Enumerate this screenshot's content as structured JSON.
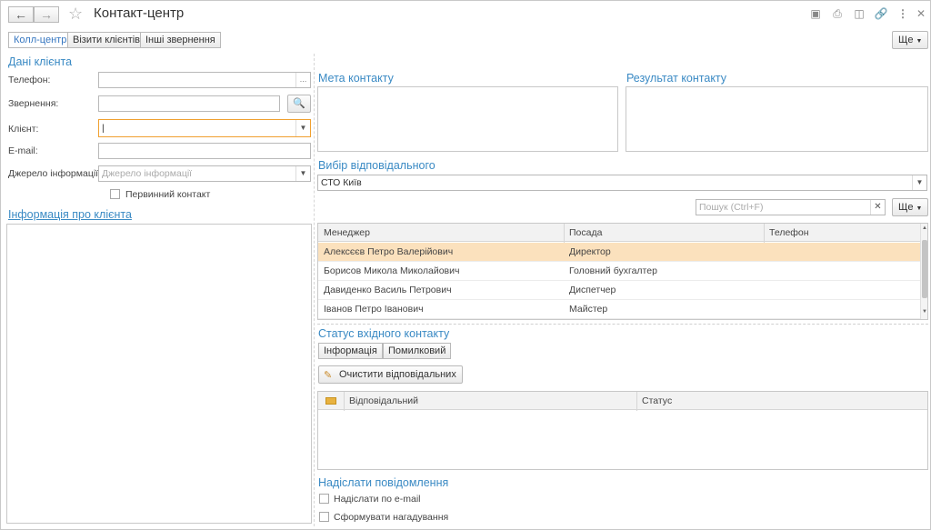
{
  "window": {
    "title": "Контакт-центр",
    "more_label": "Ще"
  },
  "tabs": [
    {
      "label": "Колл-центр"
    },
    {
      "label": "Візити клієнтів"
    },
    {
      "label": "Інші звернення"
    }
  ],
  "client": {
    "section_title": "Дані клієнта",
    "phone_label": "Телефон:",
    "phone_value": "",
    "request_label": "Звернення:",
    "request_value": "",
    "client_label": "Клієнт:",
    "client_value": "|",
    "email_label": "E-mail:",
    "email_value": "",
    "source_label": "Джерело інформації:",
    "source_placeholder": "Джерело інформації",
    "first_contact_label": "Первинний контакт",
    "info_title": "Інформація про клієнта"
  },
  "contact": {
    "goal_title": "Мета контакту",
    "result_title": "Результат контакту"
  },
  "responsible": {
    "section_title": "Вибір відповідального",
    "selected": "СТО Київ",
    "search_placeholder": "Пошук (Ctrl+F)",
    "more_label": "Ще",
    "columns": [
      "Менеджер",
      "Посада",
      "Телефон"
    ],
    "rows": [
      {
        "manager": "Алексєєв Петро Валерійович",
        "position": "Директор",
        "phone": ""
      },
      {
        "manager": "Борисов Микола Миколайович",
        "position": "Головний бухгалтер",
        "phone": ""
      },
      {
        "manager": "Давиденко Василь Петрович",
        "position": "Диспетчер",
        "phone": ""
      },
      {
        "manager": "Іванов Петро Іванович",
        "position": "Майстер",
        "phone": ""
      }
    ]
  },
  "status": {
    "section_title": "Статус вхідного контакту",
    "tab_info": "Інформація",
    "tab_error": "Помилковий",
    "clear_button": "Очистити відповідальних",
    "columns": [
      "Відповідальний",
      "Статус"
    ]
  },
  "notify": {
    "section_title": "Надіслати повідомлення",
    "email_label": "Надіслати по e-mail",
    "reminder_label": "Сформувати нагадування"
  },
  "colors": {
    "accent": "#3a8ac4",
    "selected_row": "#fbe1bd",
    "focus_border": "#f0a030"
  }
}
